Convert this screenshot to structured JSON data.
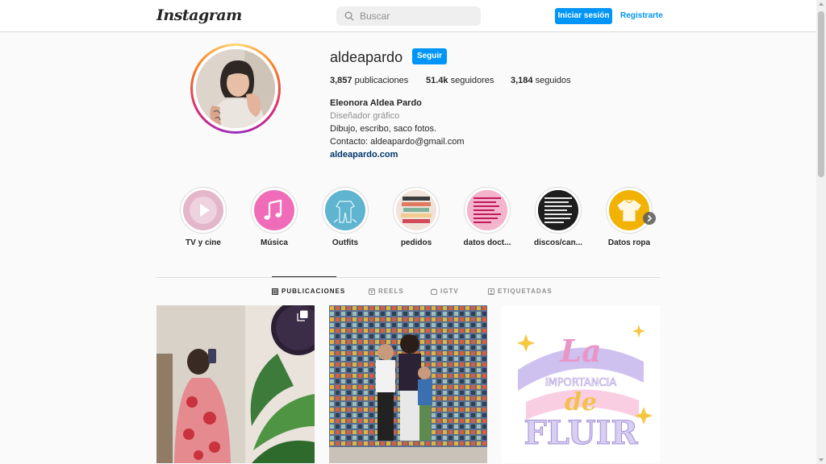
{
  "nav": {
    "logo": "Instagram",
    "search_placeholder": "Buscar",
    "login_label": "Iniciar sesión",
    "register_label": "Registrarte"
  },
  "profile": {
    "username": "aldeapardo",
    "follow_label": "Seguir",
    "posts_count": "3,857",
    "posts_label": "publicaciones",
    "followers_count": "51.4k",
    "followers_label": "seguidores",
    "following_count": "3,184",
    "following_label": "seguidos",
    "full_name": "Eleonora Aldea Pardo",
    "category": "Diseñador gráfico",
    "bio_line1": "Dibujo, escribo, saco fotos.",
    "bio_line2": "Contacto: aldeapardo@gmail.com",
    "website": "aldeapardo.com"
  },
  "highlights": [
    {
      "label": "TV y cine",
      "icon": "play-icon",
      "color": "#e3b7c9"
    },
    {
      "label": "Música",
      "icon": "music-note-icon",
      "color": "#f06cb8"
    },
    {
      "label": "Outfits",
      "icon": "outfit-icon",
      "color": "#5fb4cf"
    },
    {
      "label": "pedidos",
      "icon": "books-icon",
      "color": "#d96b59"
    },
    {
      "label": "datos doct...",
      "icon": "text-list-icon",
      "color": "#f0a6c2"
    },
    {
      "label": "discos/can...",
      "icon": "text-list-icon",
      "color": "#1e1e1e"
    },
    {
      "label": "Datos ropa",
      "icon": "shirt-icon",
      "color": "#f2b203"
    }
  ],
  "tabs": [
    {
      "label": "PUBLICACIONES",
      "icon": "grid-icon",
      "active": true
    },
    {
      "label": "REELS",
      "icon": "reels-icon",
      "active": false
    },
    {
      "label": "IGTV",
      "icon": "igtv-icon",
      "active": false
    },
    {
      "label": "ETIQUETADAS",
      "icon": "tagged-icon",
      "active": false
    }
  ],
  "posts": [
    {
      "type": "carousel",
      "icon": "multiple-images-icon"
    },
    {
      "type": "image"
    },
    {
      "type": "image",
      "text": "La importancia de fluir"
    }
  ],
  "colors": {
    "accent": "#0095f6",
    "text": "#262626",
    "muted": "#8e8e8e",
    "link": "#00376b"
  }
}
